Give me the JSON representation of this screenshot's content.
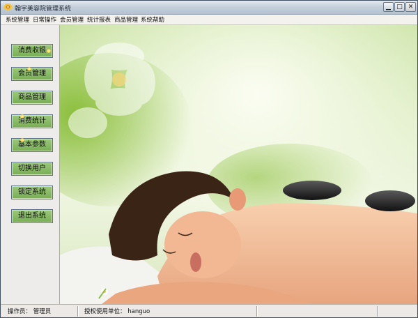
{
  "window": {
    "title": "翰宇美容院管理系统",
    "controls": {
      "minimize": "▁",
      "maximize": "□",
      "close": "✕"
    }
  },
  "menu": [
    "系统管理",
    "日常操作",
    "会员管理",
    "统计报表",
    "商品管理",
    "系统帮助"
  ],
  "sidebar": {
    "buttons": [
      {
        "label": "消费收银"
      },
      {
        "label": "会员管理"
      },
      {
        "label": "商品管理"
      },
      {
        "label": "消费统计"
      },
      {
        "label": "基本参数"
      },
      {
        "label": "切换用户"
      },
      {
        "label": "锁定系统"
      },
      {
        "label": "退出系统"
      }
    ]
  },
  "status": {
    "operator_label": "操作员：",
    "operator_value": "管理员",
    "licensee_label": "授权使用单位：",
    "licensee_value": "hanguo"
  },
  "icons": {
    "app": "flower-icon",
    "minimize": "minimize-icon",
    "maximize": "maximize-icon",
    "close": "close-icon"
  }
}
